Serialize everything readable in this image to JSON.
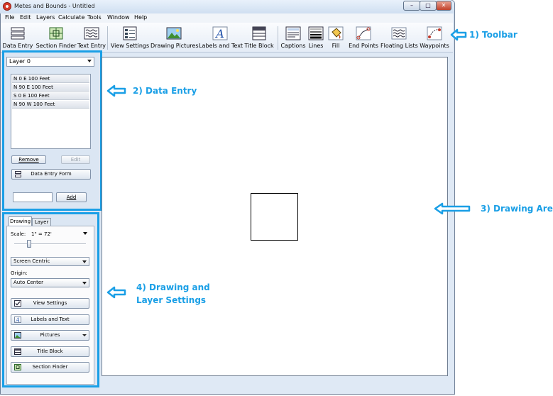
{
  "window": {
    "title": "Metes and Bounds - Untitled",
    "controls": {
      "minimize": "–",
      "maximize": "□",
      "close": "✕"
    }
  },
  "menu": [
    "File",
    "Edit",
    "Layers",
    "Calculate",
    "Tools",
    "Window",
    "Help"
  ],
  "toolbar": {
    "data_entry": "Data Entry",
    "section_finder": "Section Finder",
    "text_entry": "Text Entry",
    "view_settings": "View Settings",
    "drawing_pictures": "Drawing Pictures",
    "labels_and_text": "Labels and Text",
    "title_block": "Title Block",
    "captions": "Captions",
    "lines": "Lines",
    "fill": "Fill",
    "end_points": "End Points",
    "floating_lists": "Floating Lists",
    "waypoints": "Waypoints"
  },
  "data_entry": {
    "layer": "Layer 0",
    "calls": [
      "N 0 E 100 Feet",
      "N 90 E 100 Feet",
      "S 0 E 100 Feet",
      "N 90 W 100 Feet"
    ],
    "remove_label": "Remove",
    "edit_label": "Edit",
    "form_label": "Data Entry Form",
    "quick_input": "",
    "add_label": "Add"
  },
  "settings": {
    "tabs": [
      "Drawing",
      "Layer"
    ],
    "scale_label": "Scale:",
    "scale_value": "1\" = 72'",
    "centric": "Screen Centric",
    "origin_label": "Origin:",
    "origin_value": "Auto Center",
    "buttons": {
      "view_settings": "View Settings",
      "labels_and_text": "Labels and Text",
      "pictures": "Pictures",
      "title_block": "Title Block",
      "section_finder": "Section Finder"
    }
  },
  "annotations": {
    "toolbar": "1) Toolbar",
    "data_entry": "2) Data Entry",
    "drawing_area": "3) Drawing Area",
    "settings_line1": "4) Drawing and",
    "settings_line2": "Layer Settings"
  },
  "colors": {
    "accent": "#1a9fe6",
    "window_frame": "#dfe9f5",
    "panel": "#dbe6f3"
  }
}
